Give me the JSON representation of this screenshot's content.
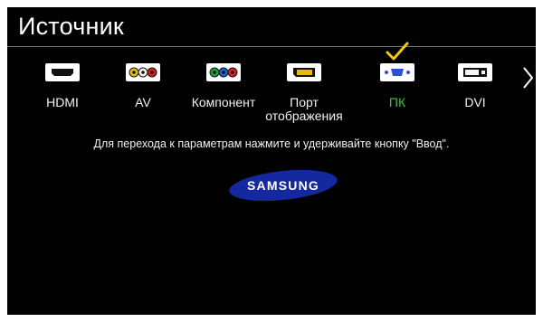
{
  "header": {
    "title": "Источник"
  },
  "sources": [
    {
      "label": "HDMI",
      "icon": "hdmi-port-icon"
    },
    {
      "label": "AV",
      "icon": "av-rca-icon"
    },
    {
      "label": "Компонент",
      "icon": "component-rca-icon"
    },
    {
      "label": "Порт\nотображения",
      "icon": "displayport-icon"
    },
    {
      "label": "ПК",
      "icon": "vga-pc-icon",
      "selected": true
    },
    {
      "label": "DVI",
      "icon": "dvi-port-icon"
    }
  ],
  "hint": "Для перехода к параметрам нажмите и удерживайте кнопку \"Ввод\".",
  "brand": {
    "logo_text": "SAMSUNG"
  },
  "colors": {
    "background": "#010101",
    "text": "#ffffff",
    "selected_label": "#3bc23b",
    "checkmark": "#f3c619",
    "logo_blue": "#1428a0"
  }
}
